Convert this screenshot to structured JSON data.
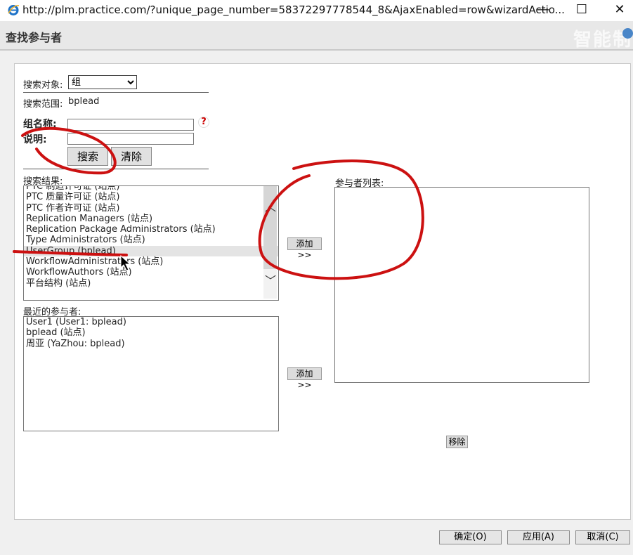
{
  "window": {
    "url": "http://plm.practice.com/?unique_page_number=58372297778544_8&AjaxEnabled=row&wizardActio...",
    "minimize_label": "—",
    "maximize_label": "☐",
    "close_label": "✕"
  },
  "header": {
    "title": "查找参与者",
    "watermark": "智能制"
  },
  "search": {
    "object_label": "搜索对象:",
    "object_value": "组",
    "scope_label": "搜索范围:",
    "scope_value": "bplead",
    "group_name_label": "组名称:",
    "group_name_value": "",
    "description_label": "说明:",
    "description_value": "",
    "help_glyph": "?",
    "search_button": "搜索",
    "clear_button": "清除"
  },
  "results": {
    "label": "搜索结果:",
    "items": [
      "PTC 制造许可证 (站点)",
      "PTC 质量许可证 (站点)",
      "PTC 作者许可证 (站点)",
      "Replication Managers (站点)",
      "Replication Package Administrators (站点)",
      "Type Administrators (站点)",
      "UserGroup (bplead)",
      "WorkflowAdministrators (站点)",
      "WorkflowAuthors (站点)",
      "平台结构 (站点)"
    ],
    "selected_index": 6,
    "add_button": "添加 >>"
  },
  "recent": {
    "label": "最近的参与者:",
    "items": [
      "User1 (User1: bplead)",
      "bplead (站点)",
      "周亚 (YaZhou: bplead)"
    ],
    "add_button": "添加 >>"
  },
  "participants": {
    "label": "参与者列表:",
    "items": [],
    "remove_button": "移除"
  },
  "footer": {
    "ok_button": "确定(O)",
    "apply_button": "应用(A)",
    "cancel_button": "取消(C)"
  },
  "colors": {
    "annotation": "#cc1111",
    "ie_blue": "#1e73c8"
  }
}
